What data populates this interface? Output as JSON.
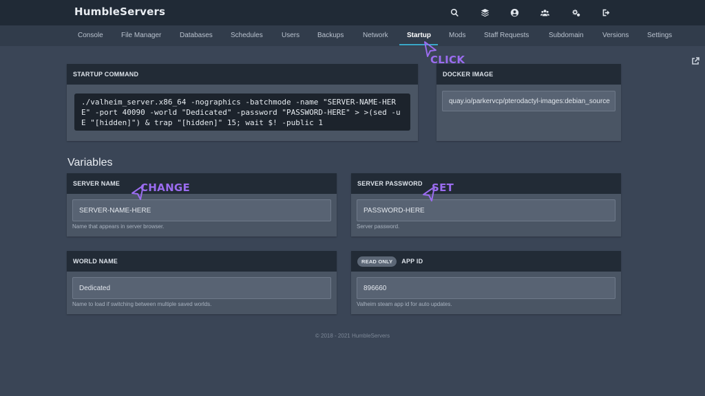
{
  "brand": {
    "name": "HumbleServers"
  },
  "top_icons": [
    "search-icon",
    "layers-icon",
    "account-icon",
    "users-icon",
    "settings-icon",
    "logout-icon"
  ],
  "subnav": {
    "items": [
      "Console",
      "File Manager",
      "Databases",
      "Schedules",
      "Users",
      "Backups",
      "Network",
      "Startup",
      "Mods",
      "Staff Requests",
      "Subdomain",
      "Versions",
      "Settings"
    ],
    "active": "Startup",
    "external_icon": "external-link-icon"
  },
  "startup": {
    "title": "STARTUP COMMAND",
    "command": "./valheim_server.x86_64 -nographics -batchmode -name \"SERVER-NAME-HERE\" -port 40090 -world \"Dedicated\" -password \"PASSWORD-HERE\" > >(sed -uE \"[hidden]\") & trap \"[hidden]\" 15; wait $! -public 1"
  },
  "docker": {
    "title": "DOCKER IMAGE",
    "value": "quay.io/parkervcp/pterodactyl-images:debian_source"
  },
  "variables": {
    "title": "Variables",
    "server_name": {
      "label": "SERVER NAME",
      "value": "SERVER-NAME-HERE",
      "description": "Name that appears in server browser."
    },
    "server_password": {
      "label": "SERVER PASSWORD",
      "value": "PASSWORD-HERE",
      "description": "Server password."
    },
    "world_name": {
      "label": "WORLD NAME",
      "value": "Dedicated",
      "description": "Name to load if switching between multiple saved worlds."
    },
    "app_id": {
      "badge": "READ ONLY",
      "label": "APP ID",
      "value": "896660",
      "description": "Valheim steam app id for auto updates."
    }
  },
  "annotations": {
    "click": "CLICK",
    "change": "CHANGE",
    "set": "SET"
  },
  "footer": {
    "text": "© 2018 - 2021 HumbleServers"
  },
  "colors": {
    "accent": "#3aa8c9",
    "annotation": "#9b6cf0",
    "background": "#3a4556",
    "header": "#202a36"
  }
}
